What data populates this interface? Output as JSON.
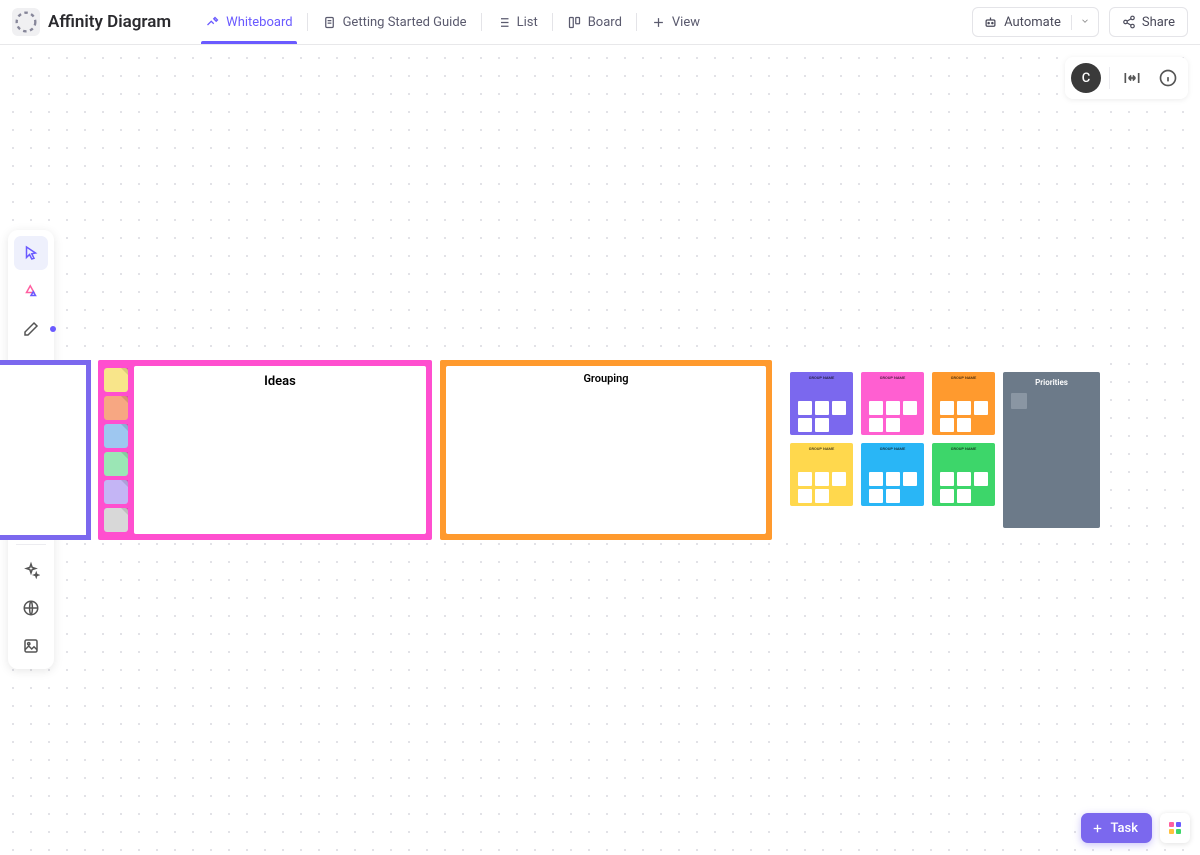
{
  "header": {
    "title": "Affinity Diagram",
    "tabs": [
      {
        "label": "Whiteboard",
        "icon": "whiteboard-icon",
        "active": true
      },
      {
        "label": "Getting Started Guide",
        "icon": "doc-icon"
      },
      {
        "label": "List",
        "icon": "list-icon"
      },
      {
        "label": "Board",
        "icon": "board-icon"
      },
      {
        "label": "View",
        "icon": "plus-icon"
      }
    ],
    "automate_label": "Automate",
    "share_label": "Share"
  },
  "floatbar": {
    "avatar_initial": "C"
  },
  "toolbar": {
    "tools": [
      {
        "name": "select",
        "active": true
      },
      {
        "name": "generate"
      },
      {
        "name": "pen",
        "dot": "#6a5aff"
      },
      {
        "name": "shape",
        "dot": "#3dd66a"
      },
      {
        "name": "sticky",
        "dot": "#ffd84d"
      },
      {
        "name": "text"
      },
      {
        "name": "connector"
      },
      {
        "name": "more"
      },
      {
        "name": "ai"
      },
      {
        "name": "web"
      },
      {
        "name": "image"
      }
    ]
  },
  "whiteboard": {
    "ideas_title": "Ideas",
    "grouping_title": "Grouping",
    "note_colors": [
      "#f8e58a",
      "#f7a782",
      "#9ec7f0",
      "#9be6b5",
      "#c4b5f5",
      "#d8d8d8"
    ],
    "groups": [
      {
        "title": "GROUP NAME",
        "color": "#7b68ee"
      },
      {
        "title": "GROUP NAME",
        "color": "#ff5fd1"
      },
      {
        "title": "GROUP NAME",
        "color": "#ff9a2e"
      },
      {
        "title": "GROUP NAME",
        "color": "#ffd84d"
      },
      {
        "title": "GROUP NAME",
        "color": "#29b6f6"
      },
      {
        "title": "GROUP NAME",
        "color": "#3dd66a"
      }
    ],
    "priorities_title": "Priorities"
  },
  "bottom": {
    "task_label": "Task"
  }
}
